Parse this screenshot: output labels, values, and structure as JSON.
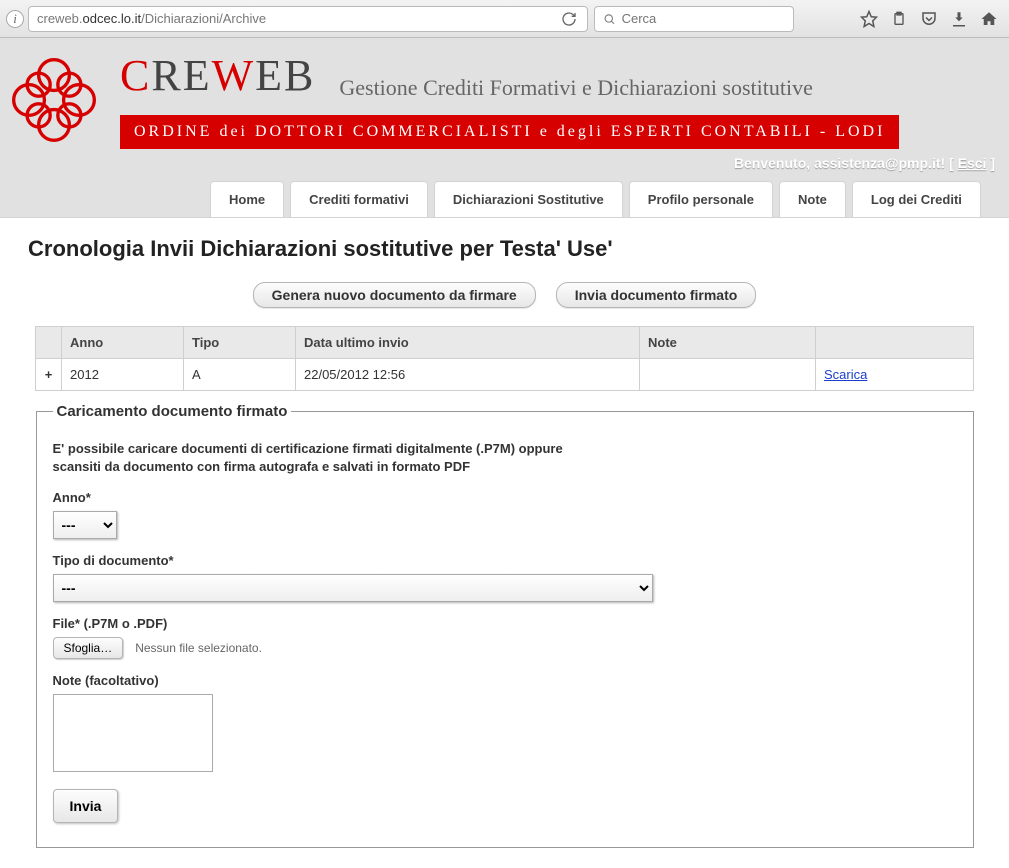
{
  "chrome": {
    "url_pre": "creweb.",
    "url_host": "odcec.lo.it",
    "url_path": "/Dichiarazioni/Archive",
    "search_placeholder": "Cerca"
  },
  "brand": {
    "letters": {
      "c": "C",
      "re": "RE",
      "w": "W",
      "eb": "EB"
    },
    "tagline": "Gestione Crediti Formativi e Dichiarazioni sostitutive",
    "redbar": "ORDINE dei DOTTORI COMMERCIALISTI e degli ESPERTI CONTABILI - LODI"
  },
  "welcome": {
    "prefix": "Benvenuto, ",
    "user": "assistenza@pmp.it",
    "excl": "!",
    "open": " [ ",
    "logout": "Esci",
    "close": " ]"
  },
  "tabs": [
    "Home",
    "Crediti formativi",
    "Dichiarazioni Sostitutive",
    "Profilo personale",
    "Note",
    "Log dei Crediti"
  ],
  "page_title": "Cronologia Invii Dichiarazioni sostitutive per Testa' Use'",
  "actions": {
    "generate": "Genera nuovo documento da firmare",
    "send": "Invia documento firmato"
  },
  "table": {
    "headers": [
      "",
      "Anno",
      "Tipo",
      "Data ultimo invio",
      "Note",
      ""
    ],
    "rows": [
      {
        "expand": "+",
        "anno": "2012",
        "tipo": "A",
        "data": "22/05/2012 12:56",
        "note": "",
        "action": "Scarica"
      }
    ]
  },
  "upload": {
    "legend": "Caricamento documento firmato",
    "help": "E' possibile caricare documenti di certificazione firmati digitalmente (.P7M) oppure scansiti da documento con firma autografa e salvati in formato PDF",
    "anno_label": "Anno*",
    "anno_value": "---",
    "tipo_label": "Tipo di documento*",
    "tipo_value": "---",
    "file_label": "File* (.P7M o .PDF)",
    "file_button": "Sfoglia…",
    "file_status": "Nessun file selezionato.",
    "note_label": "Note (facoltativo)",
    "submit": "Invia"
  }
}
